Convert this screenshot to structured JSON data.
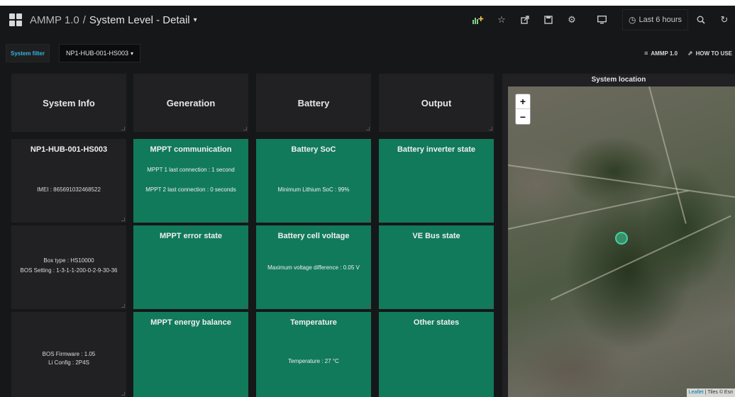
{
  "nav": {
    "folder": "AMMP 1.0",
    "separator": "/",
    "dashboard_title": "System Level - Detail",
    "time_range": "Last 6 hours",
    "icons": [
      "add-panel-icon",
      "star-icon",
      "share-icon",
      "save-icon",
      "settings-icon",
      "tv-mode-icon",
      "clock-icon",
      "zoom-out-icon",
      "refresh-icon"
    ]
  },
  "filter": {
    "label": "System filter",
    "value": "NP1-HUB-001-HS003"
  },
  "links": [
    {
      "label": "AMMP 1.0",
      "icon": "list-icon"
    },
    {
      "label": "HOW TO USE",
      "icon": "external-link-icon"
    }
  ],
  "headers": {
    "system_info": "System Info",
    "generation": "Generation",
    "battery": "Battery",
    "output": "Output"
  },
  "info": {
    "system_id": "NP1-HUB-001-HS003",
    "imei": "IMEI : 865691032468522",
    "box_type": "Box type : HS10000",
    "bos_setting": "BOS Setting : 1-3-1-1-200-0-2-9-30-36",
    "bos_firmware": "BOS Firmware : 1.05",
    "li_config": "Li Config : 2P4S"
  },
  "generation": {
    "mppt_comm_title": "MPPT communication",
    "mppt1": "MPPT 1 last connection : 1 second",
    "mppt2": "MPPT 2 last connection : 0 seconds",
    "mppt_error_title": "MPPT error state",
    "mppt_energy_title": "MPPT energy balance"
  },
  "battery": {
    "soc_title": "Battery SoC",
    "soc_value": "Minimum Lithium SoC : 99%",
    "cell_title": "Battery cell voltage",
    "cell_value": "Maximum voltage difference : 0.05 V",
    "temp_title": "Temperature",
    "temp_value": "Temperature : 27 °C"
  },
  "output": {
    "inverter_title": "Battery inverter state",
    "vebus_title": "VE Bus state",
    "other_title": "Other states"
  },
  "map": {
    "title": "System location",
    "zoom_in": "+",
    "zoom_out": "−",
    "attribution_link": "Leaflet",
    "attribution_rest": " | Tiles © Esri"
  },
  "colors": {
    "panel_green": "#117a5a",
    "panel_dark": "#212124",
    "background": "#161719",
    "marker": "#3ed3a3"
  }
}
